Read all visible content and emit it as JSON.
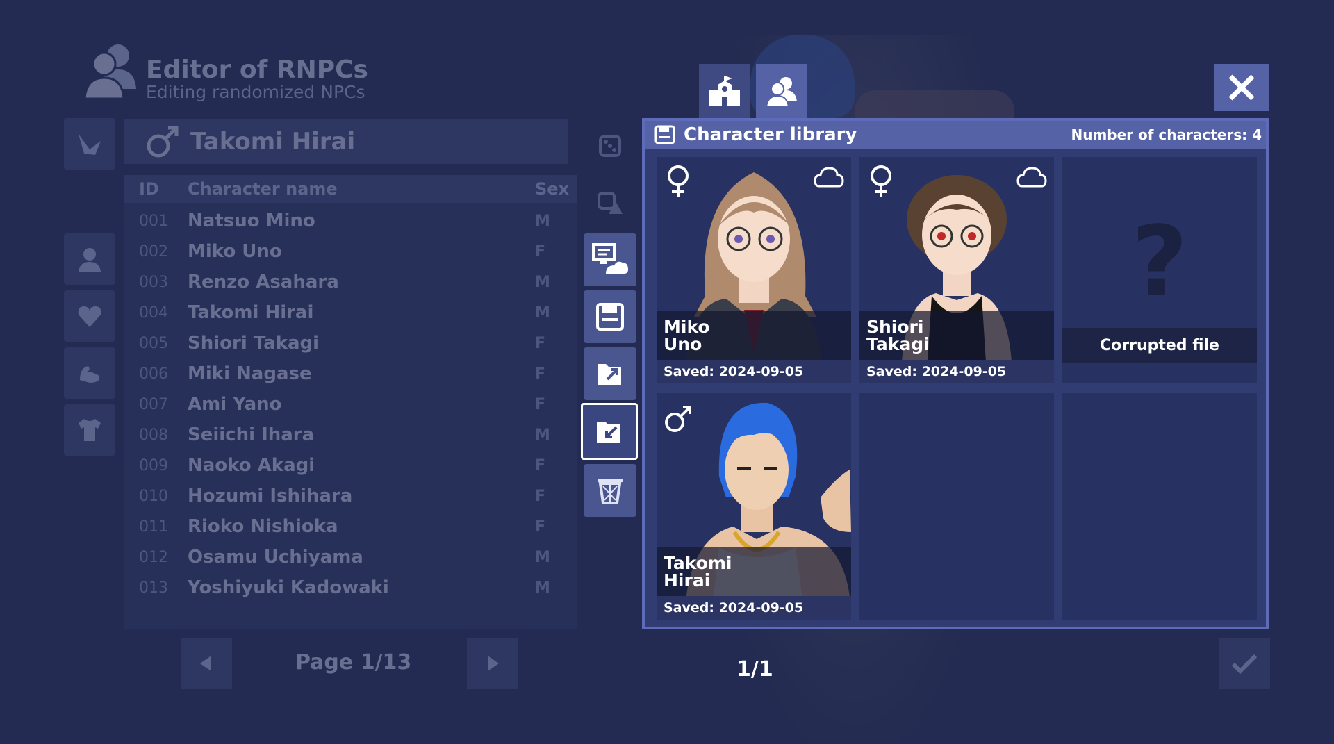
{
  "header": {
    "title": "Editor of RNPCs",
    "subtitle": "Editing randomized NPCs"
  },
  "selected_character": {
    "sex_icon": "male-symbol",
    "name": "Takomi Hirai"
  },
  "list": {
    "columns": [
      "ID",
      "Character name",
      "Sex"
    ],
    "rows": [
      {
        "id": "001",
        "name": "Natsuo Mino",
        "sex": "M"
      },
      {
        "id": "002",
        "name": "Miko Uno",
        "sex": "F"
      },
      {
        "id": "003",
        "name": "Renzo Asahara",
        "sex": "M"
      },
      {
        "id": "004",
        "name": "Takomi Hirai",
        "sex": "M"
      },
      {
        "id": "005",
        "name": "Shiori Takagi",
        "sex": "F"
      },
      {
        "id": "006",
        "name": "Miki Nagase",
        "sex": "F"
      },
      {
        "id": "007",
        "name": "Ami Yano",
        "sex": "F"
      },
      {
        "id": "008",
        "name": "Seiichi Ihara",
        "sex": "M"
      },
      {
        "id": "009",
        "name": "Naoko Akagi",
        "sex": "F"
      },
      {
        "id": "010",
        "name": "Hozumi Ishihara",
        "sex": "F"
      },
      {
        "id": "011",
        "name": "Rioko Nishioka",
        "sex": "F"
      },
      {
        "id": "012",
        "name": "Osamu Uchiyama",
        "sex": "M"
      },
      {
        "id": "013",
        "name": "Yoshiyuki Kadowaki",
        "sex": "M"
      }
    ],
    "page_label": "Page 1/13"
  },
  "library": {
    "title": "Character library",
    "count_label": "Number of characters: 4",
    "slots": [
      {
        "first": "Miko",
        "last": "Uno",
        "saved": "Saved: 2024-09-05",
        "sex": "female",
        "cloud": true
      },
      {
        "first": "Shiori",
        "last": "Takagi",
        "saved": "Saved: 2024-09-05",
        "sex": "female",
        "cloud": true
      },
      {
        "corrupt_label": "Corrupted file",
        "mark": "?"
      },
      {
        "first": "Takomi",
        "last": "Hirai",
        "saved": "Saved: 2024-09-05",
        "sex": "male",
        "cloud": false
      }
    ],
    "page_indicator": "1/1"
  },
  "colors": {
    "background": "#232b52",
    "panel": "#313c72",
    "accent": "#5662a6",
    "border": "#5e6bb8"
  }
}
